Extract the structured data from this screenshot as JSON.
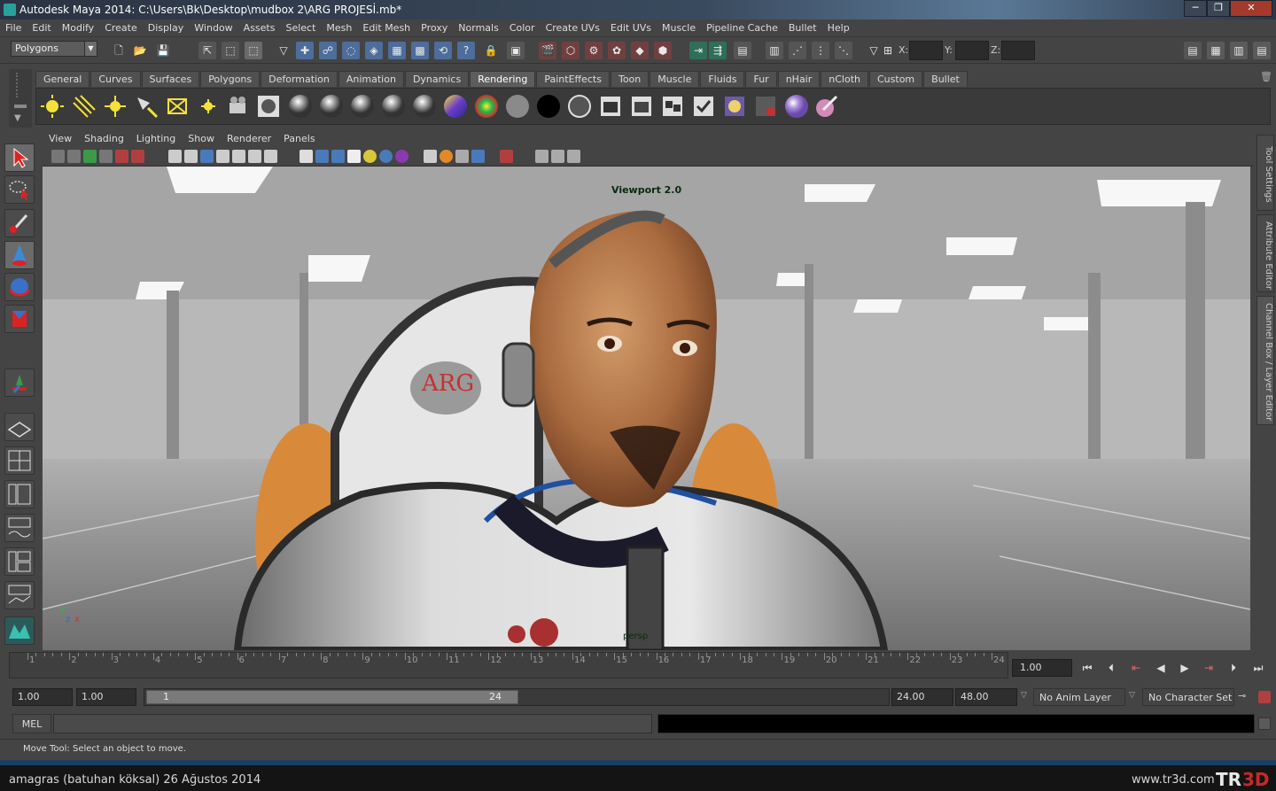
{
  "window": {
    "title": "Autodesk Maya 2014: C:\\Users\\Bk\\Desktop\\mudbox 2\\ARG PROJESİ.mb*",
    "minimize": "─",
    "maximize": "❐",
    "close": "✕"
  },
  "menubar": [
    "File",
    "Edit",
    "Modify",
    "Create",
    "Display",
    "Window",
    "Assets",
    "Select",
    "Mesh",
    "Edit Mesh",
    "Proxy",
    "Normals",
    "Color",
    "Create UVs",
    "Edit UVs",
    "Muscle",
    "Pipeline Cache",
    "Bullet",
    "Help"
  ],
  "status_line": {
    "mode": "Polygons",
    "x_label": "X:",
    "y_label": "Y:",
    "z_label": "Z:"
  },
  "shelf": {
    "tabs": [
      "General",
      "Curves",
      "Surfaces",
      "Polygons",
      "Deformation",
      "Animation",
      "Dynamics",
      "Rendering",
      "PaintEffects",
      "Toon",
      "Muscle",
      "Fluids",
      "Fur",
      "nHair",
      "nCloth",
      "Custom",
      "Bullet"
    ],
    "active_tab": "Rendering"
  },
  "panel": {
    "menus": [
      "View",
      "Shading",
      "Lighting",
      "Show",
      "Renderer",
      "Panels"
    ],
    "renderer_label": "Viewport 2.0",
    "camera_label": "persp",
    "axis_y": "y",
    "axis_z": "z",
    "axis_x": "x"
  },
  "side_tabs": [
    "Tool Settings",
    "Attribute Editor",
    "Channel Box / Layer Editor"
  ],
  "time_slider": {
    "frames": [
      "1",
      "2",
      "3",
      "4",
      "5",
      "6",
      "7",
      "8",
      "9",
      "10",
      "11",
      "12",
      "13",
      "14",
      "15",
      "16",
      "17",
      "18",
      "19",
      "20",
      "21",
      "22",
      "23",
      "24"
    ],
    "current_frame": "1.00"
  },
  "playback": {
    "go_start": "⏮",
    "step_back": "⏭",
    "key_back": "|◀",
    "play_back": "◀",
    "play_fwd": "▶",
    "key_fwd": "▶|",
    "step_fwd": "⏭",
    "go_end": "⏭"
  },
  "range": {
    "start": "1.00",
    "playback_start": "1.00",
    "thumb_start": "1",
    "thumb_end": "24",
    "playback_end": "24.00",
    "end": "48.00",
    "anim_layer": "No Anim Layer",
    "character_set": "No Character Set"
  },
  "command_line": {
    "label": "MEL"
  },
  "help_line": "Move Tool: Select an object to move.",
  "caption": {
    "author": "amagras (batuhan köksal)  26 Ağustos 2014",
    "site": "www.tr3d.com",
    "logo": "TR3D"
  },
  "viewport": {
    "emblem": "ARG"
  }
}
